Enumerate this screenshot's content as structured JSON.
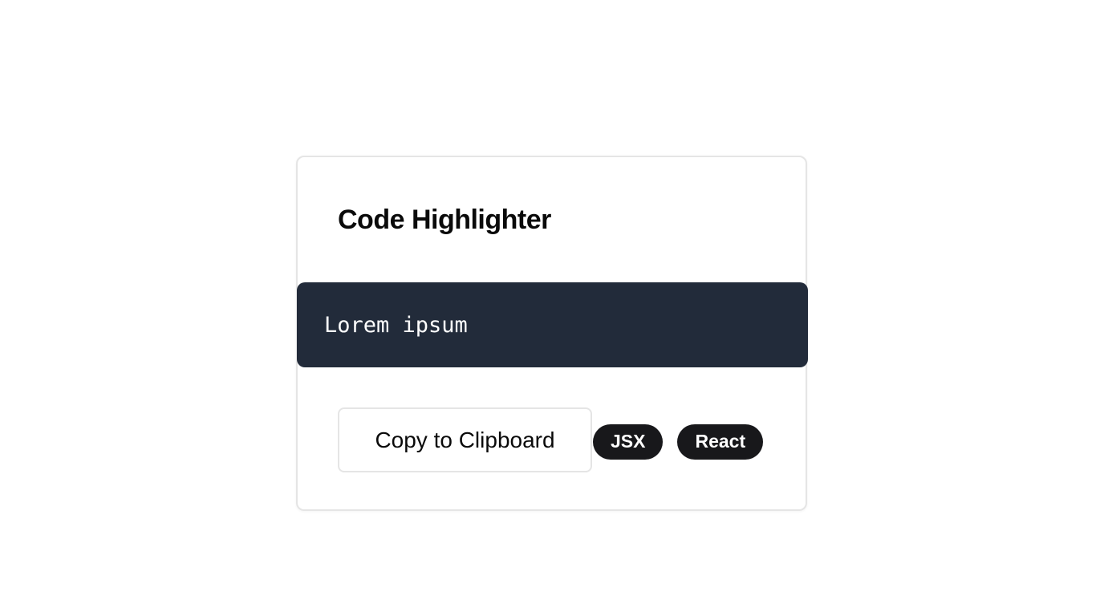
{
  "card": {
    "title": "Code Highlighter",
    "code": "Lorem ipsum",
    "copy_label": "Copy to Clipboard",
    "tags": [
      "JSX",
      "React"
    ]
  },
  "colors": {
    "code_background": "#222b3a",
    "tag_background": "#18181b",
    "border": "#e5e5e5"
  }
}
